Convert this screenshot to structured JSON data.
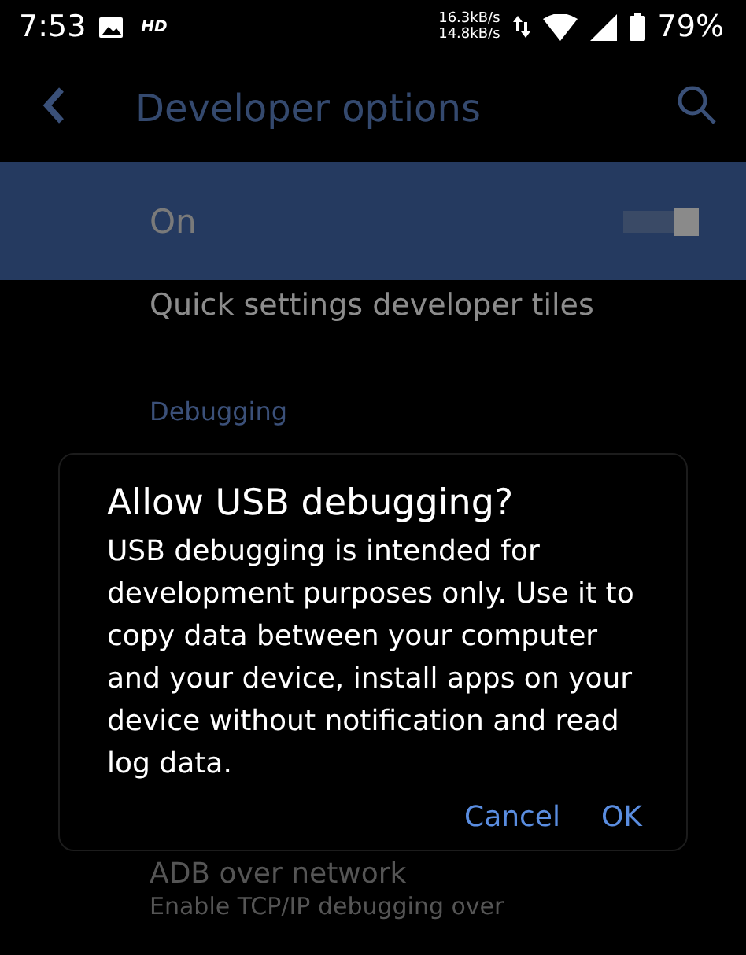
{
  "status_bar": {
    "time": "7:53",
    "hd": "HD",
    "upload_speed": "16.3kB/s",
    "download_speed": "14.8kB/s",
    "battery": "79%"
  },
  "toolbar": {
    "title": "Developer options"
  },
  "master_switch": {
    "label": "On",
    "on": true
  },
  "items": [
    {
      "kind": "item",
      "title": "Quick settings developer tiles"
    },
    {
      "kind": "header",
      "title": "Debugging"
    }
  ],
  "dialog": {
    "title": "Allow USB debugging?",
    "message": "USB debugging is intended for development purposes only. Use it to copy data between your computer and your device, install apps on your device without notification and read log data.",
    "buttons": [
      "Cancel",
      "OK"
    ]
  },
  "below_dialog": [
    {
      "title": "ADB over network",
      "summary": "Enable TCP/IP debugging over"
    }
  ]
}
